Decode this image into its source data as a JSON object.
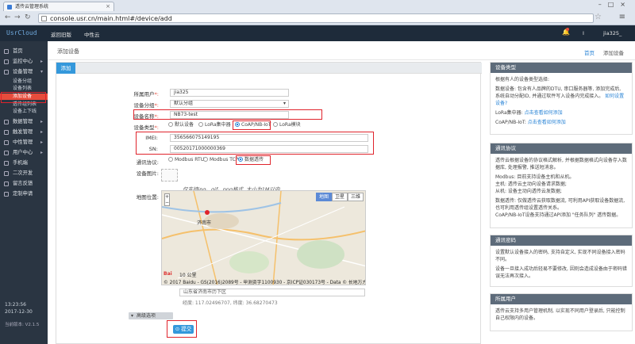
{
  "browser": {
    "tab_title": "透传云管理系统",
    "url": "console.usr.cn/main.html#/device/add"
  },
  "topbar": {
    "logo": "UsrCloud",
    "nav": [
      "返回旧版",
      "中性云"
    ],
    "user_initial": "I",
    "username": "jia325_"
  },
  "sidebar": {
    "items": [
      {
        "label": "首页"
      },
      {
        "label": "监控中心",
        "caret": "▸"
      },
      {
        "label": "设备管理",
        "caret": "▾"
      },
      {
        "label": "数据管理",
        "caret": "▸"
      },
      {
        "label": "触发管理",
        "caret": "▸"
      },
      {
        "label": "中性管理",
        "caret": "▸"
      },
      {
        "label": "用户中心",
        "caret": "▸"
      },
      {
        "label": "手机端"
      },
      {
        "label": "二次开发"
      },
      {
        "label": "留言反馈"
      },
      {
        "label": "定制申请"
      }
    ],
    "sub": [
      "设备分组",
      "设备列表",
      "添加设备",
      "透传组列表",
      "设备上下线"
    ],
    "time": "13:23:56",
    "date": "2017-12-30",
    "version": "当前版本: V2.1.5"
  },
  "header": {
    "title": "添加设备",
    "crumbs": [
      "首页",
      "添加设备"
    ]
  },
  "form": {
    "tab": "添加",
    "labels": {
      "owner": "所属用户",
      "group": "设备分组",
      "name": "设备名称",
      "type": "设备类型",
      "imei": "IMEI",
      "sn": "SN",
      "protocol": "通讯协议",
      "image": "设备图片",
      "map": "地图位置"
    },
    "owner_value": "jia325",
    "group_value": "默认分组",
    "name_value": "NB73-test",
    "types": [
      "默认设备",
      "LoRa集中器",
      "CoAP/NB-IoT",
      "LoRa模块"
    ],
    "imei_value": "356566075149195",
    "sn_value": "00520171000000369",
    "protocols": [
      "Modbus RTU",
      "Modbus TCP",
      "数据透传"
    ],
    "image_hint": "仅支持jpg、gif、png格式, 大小为1M以内",
    "map_types": [
      "地图",
      "卫星",
      "三维"
    ],
    "map_scale": "10 公里",
    "map_copyright": "© 2017 Baidu - GS(2016)2089号 - 甲测资字1100930 - 京ICP证030173号 - Data © 长地万方",
    "map_city": "济南市",
    "address": "山东省济南市历下区",
    "coords": "经度: 117.02496707, 纬度: 36.68270473",
    "advanced": "高级选项",
    "submit": "提交"
  },
  "right_panels": {
    "p1": {
      "title": "设备类型",
      "intro": "根据有人的设备类型选择:",
      "line1": "数据设备: 包含有人品牌的DTU, 串口服务器等, 添加完成后, 系统自动分配ID, 并通过软件写入设备内完成接入。",
      "link1": "如何设置设备?",
      "lora_label": "LoRa集中器:",
      "lora_link": "点击查看如何添加",
      "coap_label": "CoAP/NB-IoT:",
      "coap_link": "点击查看如何添加"
    },
    "p2": {
      "title": "通讯协议",
      "line1": "透传云根据设备的协议格式解析, 并根据数据格式向设备存入数据库, 处理报警, 推送短消息。",
      "line2": "Modbus: 目前支持设备主机和从机。",
      "line3": "主机: 透传云主动向设备请求数据;",
      "line4": "从机: 设备主动向透传云发数据;",
      "line5": "数据透传: 仅做透传云获取数据流, 可利用API获取设备数据流, 也可利用透传组设置透传关系。",
      "line6": "CoAP/NB-IoT设备支持通过API添加 \"任务队列\" 透传数据。"
    },
    "p3": {
      "title": "通讯密码",
      "line1": "设置默认设备接入的密码, 支持自定义, 实现不同设备接入密码不同。",
      "line2": "设备一旦接入成功后轻易不要修改, 因则会造成设备由于密码错误无法再次接入。"
    },
    "p4": {
      "title": "所属用户",
      "line1": "透传云支持多用户管理机制, 以实现不同用户登录后, 只能控制自己权限内的设备。"
    }
  }
}
